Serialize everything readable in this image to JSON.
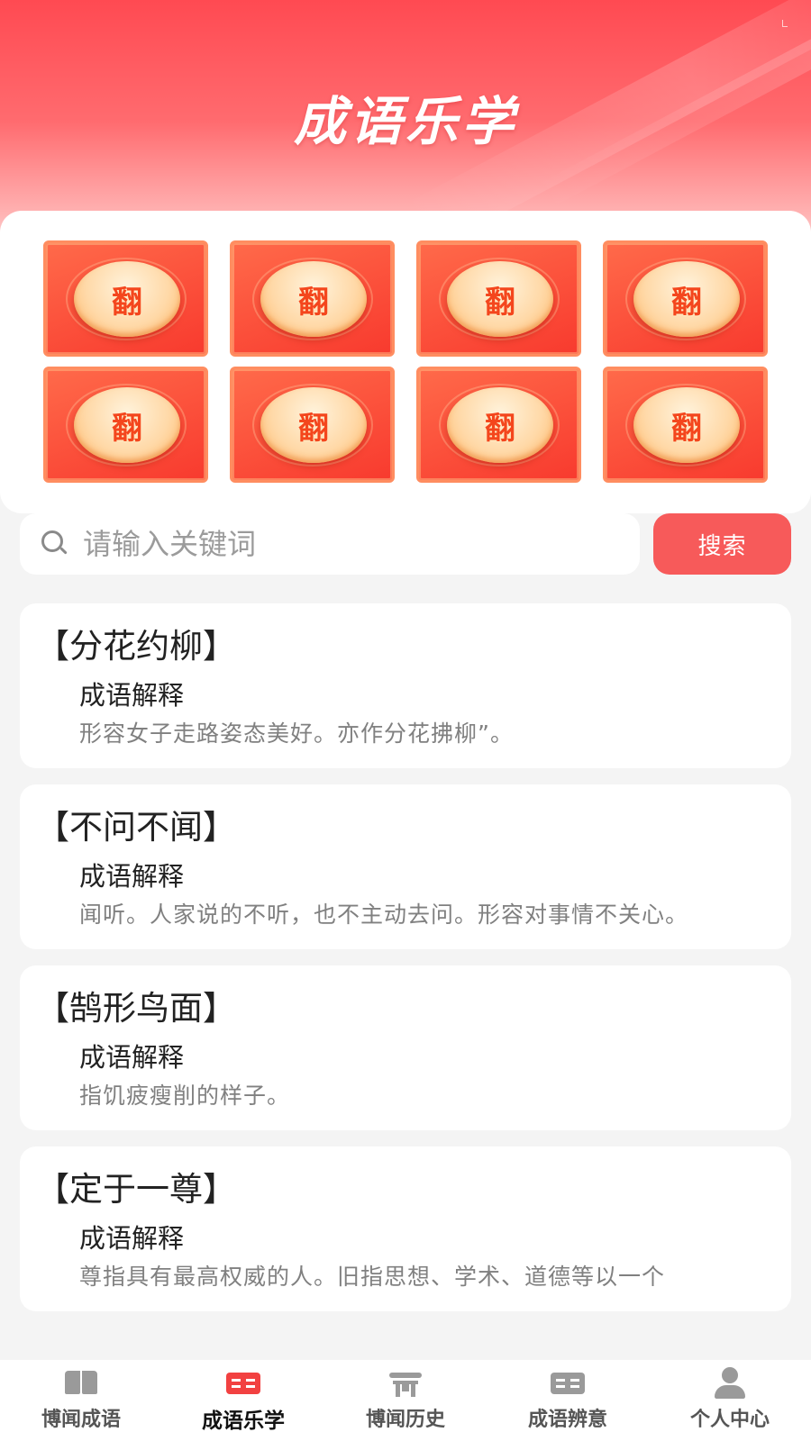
{
  "header": {
    "title": "成语乐学"
  },
  "cards": {
    "tile_label": "翻",
    "tiles": [
      "翻",
      "翻",
      "翻",
      "翻",
      "翻",
      "翻",
      "翻",
      "翻"
    ]
  },
  "search": {
    "placeholder": "请输入关键词",
    "button_label": "搜索"
  },
  "idioms": [
    {
      "title": "【分花约柳】",
      "subtitle": "成语解释",
      "desc": "形容女子走路姿态美好。亦作分花拂柳”。"
    },
    {
      "title": "【不问不闻】",
      "subtitle": "成语解释",
      "desc": "闻听。人家说的不听，也不主动去问。形容对事情不关心。"
    },
    {
      "title": "【鹄形鸟面】",
      "subtitle": "成语解释",
      "desc": "指饥疲瘦削的样子。"
    },
    {
      "title": "【定于一尊】",
      "subtitle": "成语解释",
      "desc": "尊指具有最高权威的人。旧指思想、学术、道德等以一个"
    }
  ],
  "tabbar": {
    "active_color": "#f24141",
    "tabs": [
      {
        "label": "博闻成语",
        "icon": "book-icon",
        "active": false
      },
      {
        "label": "成语乐学",
        "icon": "reading-icon",
        "active": true
      },
      {
        "label": "博闻历史",
        "icon": "gate-icon",
        "active": false
      },
      {
        "label": "成语辨意",
        "icon": "open-book-icon",
        "active": false
      },
      {
        "label": "个人中心",
        "icon": "user-icon",
        "active": false
      }
    ]
  }
}
